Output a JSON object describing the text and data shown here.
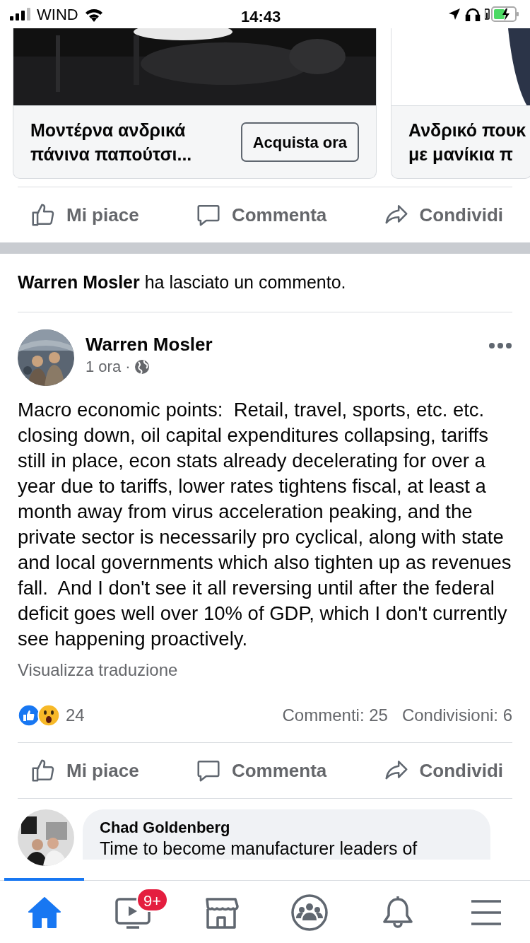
{
  "status_bar": {
    "carrier": "WIND",
    "time": "14:43"
  },
  "ads": [
    {
      "title_lines": [
        "Μοντέρνα ανδρικά",
        "πάνινα παπούτσι..."
      ],
      "button": "Acquista ora"
    },
    {
      "title_lines": [
        "Ανδρικό πουκ",
        "με μανίκια π"
      ]
    }
  ],
  "top_actions": [
    "Mi piace",
    "Commenta",
    "Condividi"
  ],
  "activity": "**Warren Mosler** ha lasciato un commento.",
  "post": {
    "author": "Warren Mosler",
    "time": "1 ora",
    "time_separator": "·",
    "text": "Macro economic points:  Retail, travel, sports, etc. etc. closing down, oil capital expenditures collapsing, tariffs still in place, econ stats already decelerating for over a year due to tariffs, lower rates tightens fiscal, at least a month away from virus acceleration peaking, and the private sector is necessarily pro cyclical, along with state and local governments which also tighten up as revenues fall.  And I don't see it all reversing until after the federal deficit goes well over 10% of GDP, which I don't currently see happening proactively.",
    "translate": "Visualizza traduzione",
    "reaction_count": "24",
    "comments": "Commenti: 25",
    "shares": "Condivisioni: 6"
  },
  "actions": [
    "Mi piace",
    "Commenta",
    "Condividi"
  ],
  "comment": {
    "author": "Chad Goldenberg",
    "text": "Time to become manufacturer leaders of"
  },
  "tab_bar": [
    {
      "kind": "home",
      "selected": true
    },
    {
      "kind": "video",
      "selected": false,
      "badge": "9+"
    },
    {
      "kind": "marketplace",
      "selected": false
    },
    {
      "kind": "groups",
      "selected": false
    },
    {
      "kind": "notifications",
      "selected": false
    },
    {
      "kind": "menu",
      "selected": false
    }
  ]
}
